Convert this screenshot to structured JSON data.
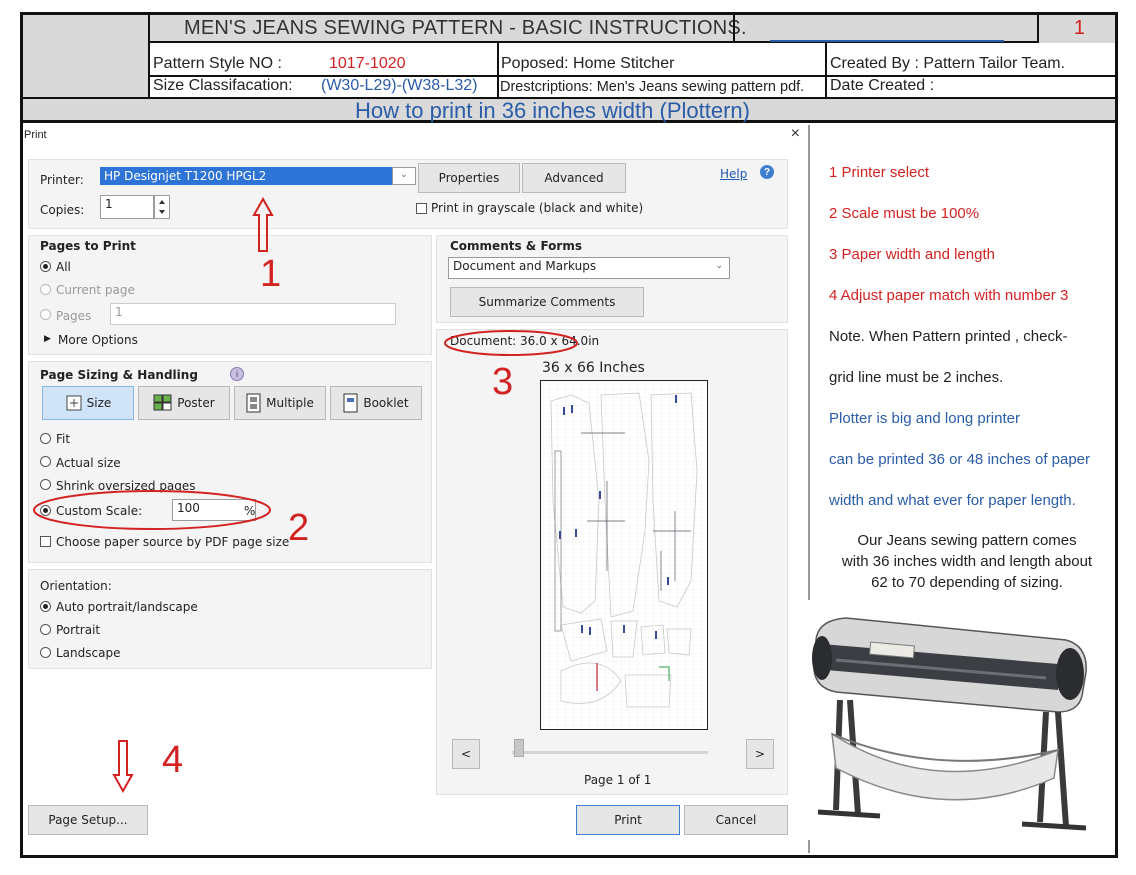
{
  "header": {
    "title": "MEN'S JEANS SEWING PATTERN - BASIC INSTRUCTIONS.",
    "page_number": "1",
    "pattern_style_label": "Pattern Style   NO :",
    "pattern_style_value": "1017-1020",
    "size_class_label": "Size Classifacation:",
    "size_class_value": "(W30-L29)-(W38-L32)",
    "proposed": "Poposed: Home Stitcher",
    "descriptions": "Drestcriptions:  Men's Jeans sewing pattern pdf.",
    "created_by": "Created By : Pattern Tailor Team.",
    "date_created": "Date Created :",
    "howto": "How to print in 36 inches width  (Plottern)"
  },
  "dialog": {
    "title": "Print",
    "close": "×",
    "printer_label": "Printer:",
    "printer_value": "HP Designjet T1200 HPGL2",
    "properties": "Properties",
    "advanced": "Advanced",
    "help": "Help",
    "copies_label": "Copies:",
    "copies_value": "1",
    "grayscale": "Print in grayscale (black and white)",
    "pages_to_print": "Pages to Print",
    "all": "All",
    "current_page": "Current page",
    "pages": "Pages",
    "pages_value": "1",
    "more_options": "More Options",
    "comments_forms": "Comments & Forms",
    "comments_value": "Document and Markups",
    "summarize": "Summarize Comments",
    "document_size": "Document: 36.0 x 64.0in",
    "preview_caption": "36 x 66 Inches",
    "page_sizing": "Page Sizing & Handling",
    "size_btn": "Size",
    "poster_btn": "Poster",
    "multiple_btn": "Multiple",
    "booklet_btn": "Booklet",
    "fit": "Fit",
    "actual_size": "Actual size",
    "shrink": "Shrink oversized pages",
    "custom_scale": "Custom Scale:",
    "custom_scale_value": "100",
    "percent": "%",
    "paper_source": "Choose paper source by PDF page size",
    "orientation": "Orientation:",
    "auto_orient": "Auto portrait/landscape",
    "portrait": "Portrait",
    "landscape": "Landscape",
    "nav_prev": "<",
    "nav_next": ">",
    "page_of": "Page 1 of 1",
    "page_setup": "Page Setup...",
    "print": "Print",
    "cancel": "Cancel",
    "selected_printer_color": "#2d74d6"
  },
  "annotations": {
    "n1": "1",
    "n2": "2",
    "n3": "3",
    "n4": "4",
    "color": "#d32222"
  },
  "notes": {
    "step1": "1  Printer select",
    "step2": "2  Scale must be 100%",
    "step3": "3  Paper width and length",
    "step4": "4 Adjust paper match with number 3",
    "note_a": "Note.  When Pattern printed , check-",
    "note_b": "grid line must be 2 inches.",
    "plotter_a": "Plotter is big and long printer",
    "plotter_b": "can be printed  36 or 48 inches of paper",
    "plotter_c": "width  and  what ever for paper length.",
    "jeans_a": "Our Jeans sewing pattern comes",
    "jeans_b": "with 36 inches width and length about",
    "jeans_c": "62 to 70  depending of sizing."
  },
  "icons": [
    "up-arrow-outline-icon",
    "down-arrow-outline-icon",
    "help-icon",
    "info-icon",
    "size-icon",
    "poster-icon",
    "multiple-icon",
    "booklet-icon",
    "close-icon",
    "plotter-printer-image"
  ]
}
